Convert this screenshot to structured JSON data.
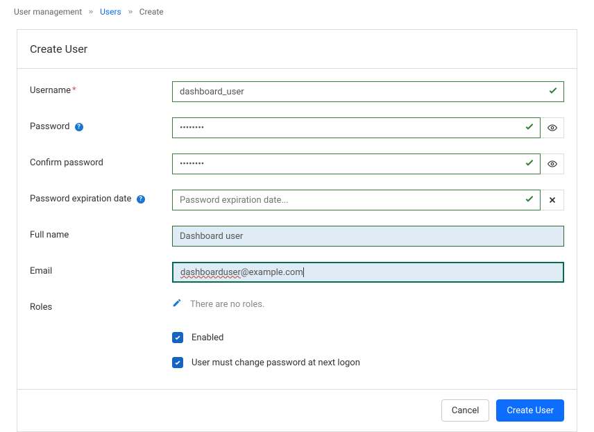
{
  "breadcrumb": {
    "root": "User management",
    "users": "Users",
    "create": "Create"
  },
  "panel": {
    "title": "Create User"
  },
  "labels": {
    "username": "Username",
    "password": "Password",
    "confirm_password": "Confirm password",
    "expiration": "Password expiration date",
    "full_name": "Full name",
    "email": "Email",
    "roles": "Roles"
  },
  "values": {
    "username": "dashboard_user",
    "password": "••••••••",
    "confirm_password": "••••••••",
    "expiration_placeholder": "Password expiration date...",
    "full_name": "Dashboard user",
    "email_prefix": "dashboarduser",
    "email_suffix": "@example.com"
  },
  "roles": {
    "empty_text": "There are no roles."
  },
  "checkboxes": {
    "enabled": "Enabled",
    "change_password": "User must change password at next logon"
  },
  "buttons": {
    "cancel": "Cancel",
    "create": "Create User"
  }
}
